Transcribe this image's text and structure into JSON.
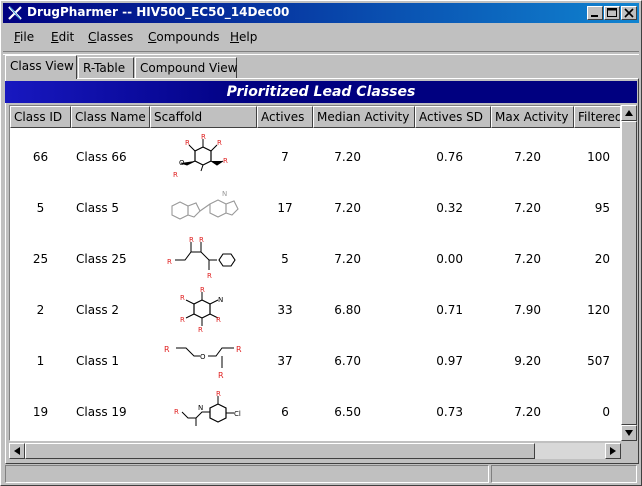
{
  "window": {
    "title": "DrugPharmer -- HIV500_EC50_14Dec00"
  },
  "menu": [
    {
      "mnemonic": "F",
      "rest": "ile"
    },
    {
      "mnemonic": "E",
      "rest": "dit"
    },
    {
      "mnemonic": "C",
      "rest": "lasses"
    },
    {
      "mnemonic": "C",
      "rest": "ompounds"
    },
    {
      "mnemonic": "H",
      "rest": "elp"
    }
  ],
  "tabs": [
    "Class View",
    "R-Table",
    "Compound View"
  ],
  "active_tab": "Class View",
  "banner": "Prioritized Lead Classes",
  "columns": [
    "Class ID",
    "Class Name",
    "Scaffold",
    "Actives",
    "Median Activity",
    "Actives SD",
    "Max Activity",
    "Filtered"
  ],
  "rows": [
    {
      "id": "66",
      "name": "Class 66",
      "scaffold": "scaffold-66",
      "actives": "7",
      "median": "7.20",
      "sd": "0.76",
      "max": "7.20",
      "filtered": "100"
    },
    {
      "id": "5",
      "name": "Class 5",
      "scaffold": "scaffold-5",
      "actives": "17",
      "median": "7.20",
      "sd": "0.32",
      "max": "7.20",
      "filtered": "95"
    },
    {
      "id": "25",
      "name": "Class 25",
      "scaffold": "scaffold-25",
      "actives": "5",
      "median": "7.20",
      "sd": "0.00",
      "max": "7.20",
      "filtered": "20"
    },
    {
      "id": "2",
      "name": "Class 2",
      "scaffold": "scaffold-2",
      "actives": "33",
      "median": "6.80",
      "sd": "0.71",
      "max": "7.90",
      "filtered": "120"
    },
    {
      "id": "1",
      "name": "Class 1",
      "scaffold": "scaffold-1",
      "actives": "37",
      "median": "6.70",
      "sd": "0.97",
      "max": "9.20",
      "filtered": "507"
    },
    {
      "id": "19",
      "name": "Class 19",
      "scaffold": "scaffold-19",
      "actives": "6",
      "median": "6.50",
      "sd": "0.73",
      "max": "7.20",
      "filtered": "0"
    }
  ],
  "icons": {
    "app": "x-logo-icon",
    "minimize": "minimize-icon",
    "maximize": "maximize-icon",
    "close": "close-icon"
  },
  "colors": {
    "title_bar": "#000080",
    "banner": "#000080",
    "r_group": "#e02020"
  }
}
